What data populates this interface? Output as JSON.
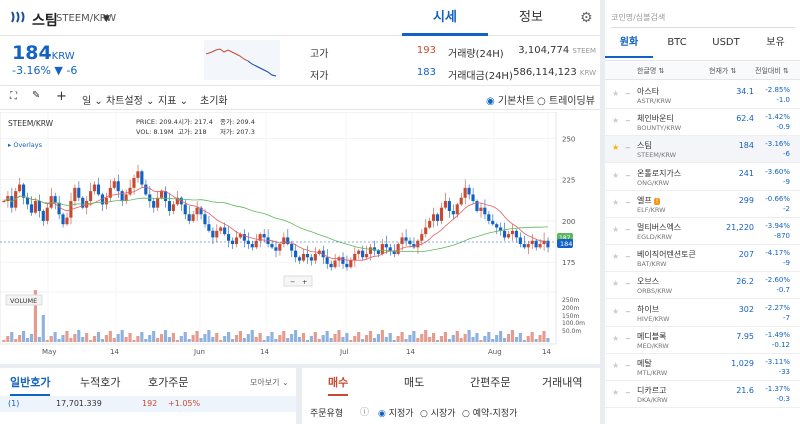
{
  "coin": {
    "name": "스팀",
    "pair": "STEEM/KRW",
    "price": "184",
    "price_unit": "KRW",
    "change": "-3.16% ▼ -6"
  },
  "top_tabs": [
    "시세",
    "정보"
  ],
  "stats": {
    "high_label": "고가",
    "high": "193",
    "low_label": "저가",
    "low": "183",
    "vol_label": "거래량(24H)",
    "vol": "3,104,774",
    "vol_unit": "STEEM",
    "amt_label": "거래대금(24H)",
    "amt": "586,114,123",
    "amt_unit": "KRW"
  },
  "toolbar": {
    "period": "일",
    "chart_settings": "차트설정",
    "indicator": "지표",
    "reset": "초기화",
    "basic_chart": "기본차트",
    "tradingview": "트레이딩뷰"
  },
  "chart": {
    "symbol": "STEEM/KRW",
    "overlays": "Overlays",
    "volume": "VOLUME",
    "info": {
      "price_l": "PRICE:",
      "price": "209.4",
      "open_l": "시가:",
      "open": "217.4",
      "close_l": "종가:",
      "close": "209.4",
      "vol_l": "VOL:",
      "vol": "8.19M",
      "high_l": "고가:",
      "high": "218",
      "low_l": "저가:",
      "low": "207.3"
    },
    "y_ticks": [
      "250",
      "225",
      "200",
      "175"
    ],
    "vol_ticks": [
      "250m",
      "200m",
      "150m",
      "100.0m",
      "50.0m"
    ],
    "x_ticks": [
      "May",
      "14",
      "Jun",
      "14",
      "Jul",
      "14",
      "Aug",
      "14"
    ],
    "last_tag": "184",
    "ma_tag": "187.6"
  },
  "chart_data": {
    "type": "candlestick",
    "ylim": [
      160,
      255
    ],
    "y_ticks": [
      250,
      225,
      200,
      175
    ],
    "last_price": 184,
    "ma_tag": 187.6,
    "x_ticks": [
      "May",
      "14",
      "Jun",
      "14",
      "Jul",
      "14",
      "Aug",
      "14"
    ],
    "vol_ticks": [
      "250m",
      "200m",
      "150m",
      "100.0m",
      "50.0m"
    ]
  },
  "orderbook": {
    "tabs": [
      "일반호가",
      "누적호가",
      "호가주문"
    ],
    "more": "모아보기",
    "row": {
      "no": "(1)",
      "qty": "17,701.339",
      "price": "192",
      "pct": "+1.05%"
    }
  },
  "order": {
    "tabs": [
      "매수",
      "매도",
      "간편주문",
      "거래내역"
    ],
    "type_label": "주문유형",
    "opts": [
      "지정가",
      "시장가",
      "예약-지정가"
    ]
  },
  "market": {
    "search_placeholder": "코인명/심볼검색",
    "tabs": [
      "원화",
      "BTC",
      "USDT",
      "보유"
    ],
    "headers": [
      "한글명",
      "현재가",
      "전일대비"
    ],
    "coins": [
      {
        "name": "아스타",
        "pair": "ASTR/KRW",
        "price": "34.1",
        "chg": "-2.85%",
        "abs": "-1.0",
        "star": false,
        "badge": ""
      },
      {
        "name": "체인바운티",
        "pair": "BOUNTY/KRW",
        "price": "62.4",
        "chg": "-1.42%",
        "abs": "-0.9",
        "star": false,
        "badge": ""
      },
      {
        "name": "스팀",
        "pair": "STEEM/KRW",
        "price": "184",
        "chg": "-3.16%",
        "abs": "-6",
        "star": true,
        "badge": ""
      },
      {
        "name": "온톨로지가스",
        "pair": "ONG/KRW",
        "price": "241",
        "chg": "-3.60%",
        "abs": "-9",
        "star": false,
        "badge": ""
      },
      {
        "name": "엘프",
        "pair": "ELF/KRW",
        "price": "299",
        "chg": "-0.66%",
        "abs": "-2",
        "star": false,
        "badge": "!"
      },
      {
        "name": "멀티버스엑스",
        "pair": "EGLD/KRW",
        "price": "21,220",
        "chg": "-3.94%",
        "abs": "-870",
        "star": false,
        "badge": ""
      },
      {
        "name": "베이직어텐션토큰",
        "pair": "BAT/KRW",
        "price": "207",
        "chg": "-4.17%",
        "abs": "-9",
        "star": false,
        "badge": ""
      },
      {
        "name": "오브스",
        "pair": "ORBS/KRW",
        "price": "26.2",
        "chg": "-2.60%",
        "abs": "-0.7",
        "star": false,
        "badge": ""
      },
      {
        "name": "하이브",
        "pair": "HIVE/KRW",
        "price": "302",
        "chg": "-2.27%",
        "abs": "-7",
        "star": false,
        "badge": ""
      },
      {
        "name": "메디블록",
        "pair": "MED/KRW",
        "price": "7.95",
        "chg": "-1.49%",
        "abs": "-0.12",
        "star": false,
        "badge": ""
      },
      {
        "name": "메탈",
        "pair": "MTL/KRW",
        "price": "1,029",
        "chg": "-3.11%",
        "abs": "-33",
        "star": false,
        "badge": ""
      },
      {
        "name": "디카르고",
        "pair": "DKA/KRW",
        "price": "21.6",
        "chg": "-1.37%",
        "abs": "-0.3",
        "star": false,
        "badge": ""
      }
    ]
  },
  "colors": {
    "accent": "#1261c4",
    "down": "#1261c4",
    "up": "#c84a31"
  }
}
